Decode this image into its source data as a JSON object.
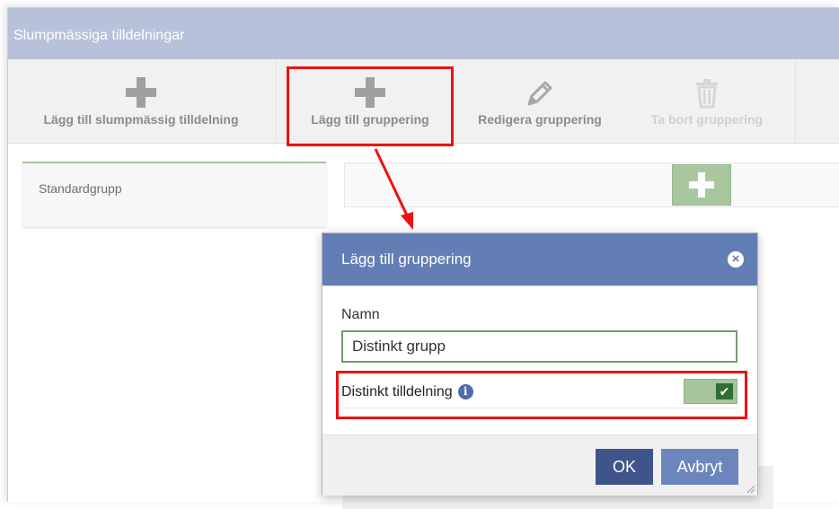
{
  "window": {
    "title": "Slumpmässiga tilldelningar"
  },
  "toolbar": {
    "buttons": [
      {
        "label": "Lägg till slumpmässig tilldelning",
        "icon": "plus-icon",
        "enabled": true
      },
      {
        "label": "Lägg till gruppering",
        "icon": "plus-icon",
        "enabled": true
      },
      {
        "label": "Redigera gruppering",
        "icon": "pencil-icon",
        "enabled": true
      },
      {
        "label": "Ta bort gruppering",
        "icon": "trash-icon",
        "enabled": false
      }
    ]
  },
  "groups": [
    {
      "name": "Standardgrupp"
    }
  ],
  "dialog": {
    "title": "Lägg till gruppering",
    "name_label": "Namn",
    "name_value": "Distinkt grupp",
    "toggle_label": "Distinkt tilldelning",
    "toggle_checked": true,
    "ok_label": "OK",
    "cancel_label": "Avbryt"
  },
  "colors": {
    "header": "#b7c2da",
    "dialog_header": "#637eb4",
    "ok_button": "#3f548a",
    "cancel_button": "#6c86bd",
    "accent_green": "#a9c79f",
    "annotation_red": "#ee1111"
  }
}
